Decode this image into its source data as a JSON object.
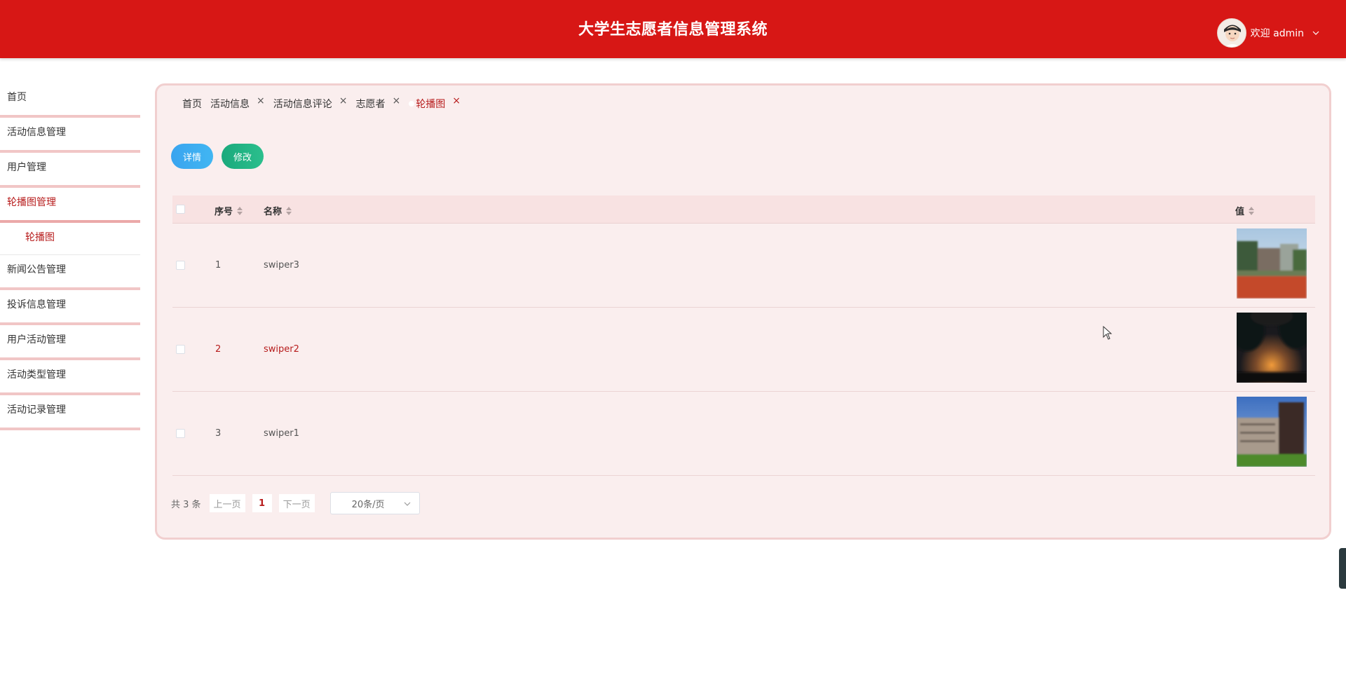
{
  "header": {
    "title": "大学生志愿者信息管理系统",
    "welcome": "欢迎 admin"
  },
  "sidebar": {
    "items": [
      {
        "label": "首页"
      },
      {
        "label": "活动信息管理"
      },
      {
        "label": "用户管理"
      },
      {
        "label": "轮播图管理",
        "active": true
      },
      {
        "label": "新闻公告管理"
      },
      {
        "label": "投诉信息管理"
      },
      {
        "label": "用户活动管理"
      },
      {
        "label": "活动类型管理"
      },
      {
        "label": "活动记录管理"
      }
    ],
    "submenu": {
      "label": "轮播图"
    }
  },
  "tabs": [
    {
      "label": "首页"
    },
    {
      "label": "活动信息",
      "close": "×"
    },
    {
      "label": "活动信息评论",
      "close": "×"
    },
    {
      "label": "志愿者",
      "close": "×"
    },
    {
      "label": "轮播图",
      "close": "×",
      "active": true
    }
  ],
  "toolbar": {
    "detail_label": "详情",
    "edit_label": "修改"
  },
  "table": {
    "headers": {
      "index": "序号",
      "name": "名称",
      "value": "值"
    },
    "rows": [
      {
        "index": "1",
        "name": "swiper3"
      },
      {
        "index": "2",
        "name": "swiper2"
      },
      {
        "index": "3",
        "name": "swiper1"
      }
    ]
  },
  "pagination": {
    "total": "共 3 条",
    "prev": "上一页",
    "page": "1",
    "next": "下一页",
    "page_size": "20条/页"
  },
  "colors": {
    "header_bg": "#d71715",
    "accent": "#b71c1c",
    "panel_bg": "#faeeee"
  }
}
